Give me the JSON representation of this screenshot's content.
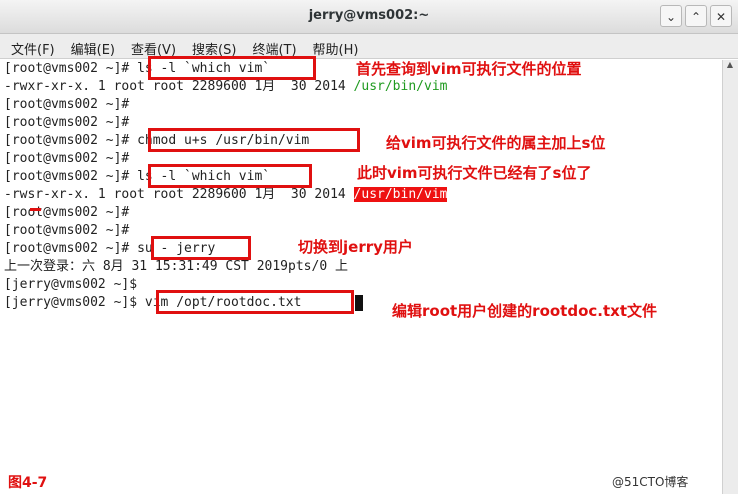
{
  "window": {
    "title": "jerry@vms002:~",
    "buttons": [
      "⌄",
      "⌃",
      "✕"
    ]
  },
  "menu": [
    "文件(F)",
    "编辑(E)",
    "查看(V)",
    "搜索(S)",
    "终端(T)",
    "帮助(H)"
  ],
  "terminal": {
    "lines": [
      {
        "prompt": "[root@vms002 ~]# ",
        "cmd": "ls -l `which vim`"
      },
      {
        "text": "-rwxr-xr-x. 1 root root 2289600 1月  30 2014 ",
        "path": "/usr/bin/vim"
      },
      {
        "prompt": "[root@vms002 ~]# ",
        "cmd": ""
      },
      {
        "prompt": "[root@vms002 ~]# ",
        "cmd": ""
      },
      {
        "prompt": "[root@vms002 ~]# ",
        "cmd": "chmod u+s /usr/bin/vim"
      },
      {
        "prompt": "[root@vms002 ~]# ",
        "cmd": ""
      },
      {
        "prompt": "[root@vms002 ~]# ",
        "cmd": "ls -l `which vim`"
      },
      {
        "text": "-rwsr-xr-x. 1 root root 2289600 1月  30 2014 ",
        "path": "/usr/bin/vim"
      },
      {
        "prompt": "[root@vms002 ~]# ",
        "cmd": ""
      },
      {
        "prompt": "[root@vms002 ~]# ",
        "cmd": ""
      },
      {
        "prompt": "[root@vms002 ~]# ",
        "cmd": "su - jerry"
      },
      {
        "text": "上一次登录：六 8月 31 15:31:49 CST 2019pts/0 上"
      },
      {
        "prompt": "[jerry@vms002 ~]$ ",
        "cmd": ""
      },
      {
        "prompt": "[jerry@vms002 ~]$ ",
        "cmd": "vim /opt/rootdoc.txt"
      }
    ]
  },
  "annotations": [
    "首先查询到vim可执行文件的位置",
    "给vim可执行文件的属主加上s位",
    "此时vim可执行文件已经有了s位了",
    "切换到jerry用户",
    "编辑root用户创建的rootdoc.txt文件"
  ],
  "figure_label": "图4-7",
  "watermark": "@51CTO博客",
  "colors": {
    "annotation": "#e01010",
    "path": "#1f9a1f",
    "path_highlight_bg": "#ee1111"
  }
}
